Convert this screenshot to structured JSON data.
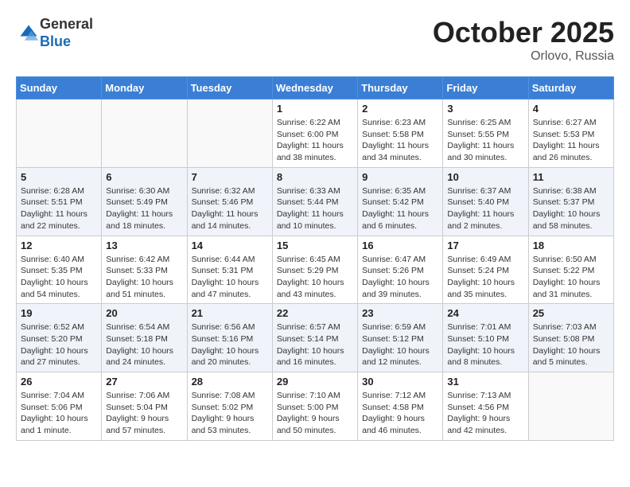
{
  "logo": {
    "general": "General",
    "blue": "Blue"
  },
  "header": {
    "month": "October 2025",
    "location": "Orlovo, Russia"
  },
  "weekdays": [
    "Sunday",
    "Monday",
    "Tuesday",
    "Wednesday",
    "Thursday",
    "Friday",
    "Saturday"
  ],
  "weeks": [
    [
      {
        "day": "",
        "info": ""
      },
      {
        "day": "",
        "info": ""
      },
      {
        "day": "",
        "info": ""
      },
      {
        "day": "1",
        "info": "Sunrise: 6:22 AM\nSunset: 6:00 PM\nDaylight: 11 hours\nand 38 minutes."
      },
      {
        "day": "2",
        "info": "Sunrise: 6:23 AM\nSunset: 5:58 PM\nDaylight: 11 hours\nand 34 minutes."
      },
      {
        "day": "3",
        "info": "Sunrise: 6:25 AM\nSunset: 5:55 PM\nDaylight: 11 hours\nand 30 minutes."
      },
      {
        "day": "4",
        "info": "Sunrise: 6:27 AM\nSunset: 5:53 PM\nDaylight: 11 hours\nand 26 minutes."
      }
    ],
    [
      {
        "day": "5",
        "info": "Sunrise: 6:28 AM\nSunset: 5:51 PM\nDaylight: 11 hours\nand 22 minutes."
      },
      {
        "day": "6",
        "info": "Sunrise: 6:30 AM\nSunset: 5:49 PM\nDaylight: 11 hours\nand 18 minutes."
      },
      {
        "day": "7",
        "info": "Sunrise: 6:32 AM\nSunset: 5:46 PM\nDaylight: 11 hours\nand 14 minutes."
      },
      {
        "day": "8",
        "info": "Sunrise: 6:33 AM\nSunset: 5:44 PM\nDaylight: 11 hours\nand 10 minutes."
      },
      {
        "day": "9",
        "info": "Sunrise: 6:35 AM\nSunset: 5:42 PM\nDaylight: 11 hours\nand 6 minutes."
      },
      {
        "day": "10",
        "info": "Sunrise: 6:37 AM\nSunset: 5:40 PM\nDaylight: 11 hours\nand 2 minutes."
      },
      {
        "day": "11",
        "info": "Sunrise: 6:38 AM\nSunset: 5:37 PM\nDaylight: 10 hours\nand 58 minutes."
      }
    ],
    [
      {
        "day": "12",
        "info": "Sunrise: 6:40 AM\nSunset: 5:35 PM\nDaylight: 10 hours\nand 54 minutes."
      },
      {
        "day": "13",
        "info": "Sunrise: 6:42 AM\nSunset: 5:33 PM\nDaylight: 10 hours\nand 51 minutes."
      },
      {
        "day": "14",
        "info": "Sunrise: 6:44 AM\nSunset: 5:31 PM\nDaylight: 10 hours\nand 47 minutes."
      },
      {
        "day": "15",
        "info": "Sunrise: 6:45 AM\nSunset: 5:29 PM\nDaylight: 10 hours\nand 43 minutes."
      },
      {
        "day": "16",
        "info": "Sunrise: 6:47 AM\nSunset: 5:26 PM\nDaylight: 10 hours\nand 39 minutes."
      },
      {
        "day": "17",
        "info": "Sunrise: 6:49 AM\nSunset: 5:24 PM\nDaylight: 10 hours\nand 35 minutes."
      },
      {
        "day": "18",
        "info": "Sunrise: 6:50 AM\nSunset: 5:22 PM\nDaylight: 10 hours\nand 31 minutes."
      }
    ],
    [
      {
        "day": "19",
        "info": "Sunrise: 6:52 AM\nSunset: 5:20 PM\nDaylight: 10 hours\nand 27 minutes."
      },
      {
        "day": "20",
        "info": "Sunrise: 6:54 AM\nSunset: 5:18 PM\nDaylight: 10 hours\nand 24 minutes."
      },
      {
        "day": "21",
        "info": "Sunrise: 6:56 AM\nSunset: 5:16 PM\nDaylight: 10 hours\nand 20 minutes."
      },
      {
        "day": "22",
        "info": "Sunrise: 6:57 AM\nSunset: 5:14 PM\nDaylight: 10 hours\nand 16 minutes."
      },
      {
        "day": "23",
        "info": "Sunrise: 6:59 AM\nSunset: 5:12 PM\nDaylight: 10 hours\nand 12 minutes."
      },
      {
        "day": "24",
        "info": "Sunrise: 7:01 AM\nSunset: 5:10 PM\nDaylight: 10 hours\nand 8 minutes."
      },
      {
        "day": "25",
        "info": "Sunrise: 7:03 AM\nSunset: 5:08 PM\nDaylight: 10 hours\nand 5 minutes."
      }
    ],
    [
      {
        "day": "26",
        "info": "Sunrise: 7:04 AM\nSunset: 5:06 PM\nDaylight: 10 hours\nand 1 minute."
      },
      {
        "day": "27",
        "info": "Sunrise: 7:06 AM\nSunset: 5:04 PM\nDaylight: 9 hours\nand 57 minutes."
      },
      {
        "day": "28",
        "info": "Sunrise: 7:08 AM\nSunset: 5:02 PM\nDaylight: 9 hours\nand 53 minutes."
      },
      {
        "day": "29",
        "info": "Sunrise: 7:10 AM\nSunset: 5:00 PM\nDaylight: 9 hours\nand 50 minutes."
      },
      {
        "day": "30",
        "info": "Sunrise: 7:12 AM\nSunset: 4:58 PM\nDaylight: 9 hours\nand 46 minutes."
      },
      {
        "day": "31",
        "info": "Sunrise: 7:13 AM\nSunset: 4:56 PM\nDaylight: 9 hours\nand 42 minutes."
      },
      {
        "day": "",
        "info": ""
      }
    ]
  ]
}
